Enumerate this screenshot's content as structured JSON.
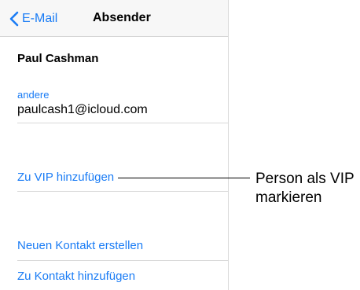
{
  "navbar": {
    "back_label": "E-Mail",
    "title": "Absender"
  },
  "contact": {
    "name": "Paul Cashman",
    "email_label": "andere",
    "email": "paulcash1@icloud.com"
  },
  "actions": {
    "add_vip": "Zu VIP hinzufügen",
    "new_contact": "Neuen Kontakt erstellen",
    "add_to_contact": "Zu Kontakt hinzufügen"
  },
  "callout": {
    "line1": "Person als VIP",
    "line2": "markieren"
  },
  "colors": {
    "accent": "#1a7cf5",
    "separator": "#d9d9d9",
    "navbar_bg": "#f7f7f7"
  }
}
